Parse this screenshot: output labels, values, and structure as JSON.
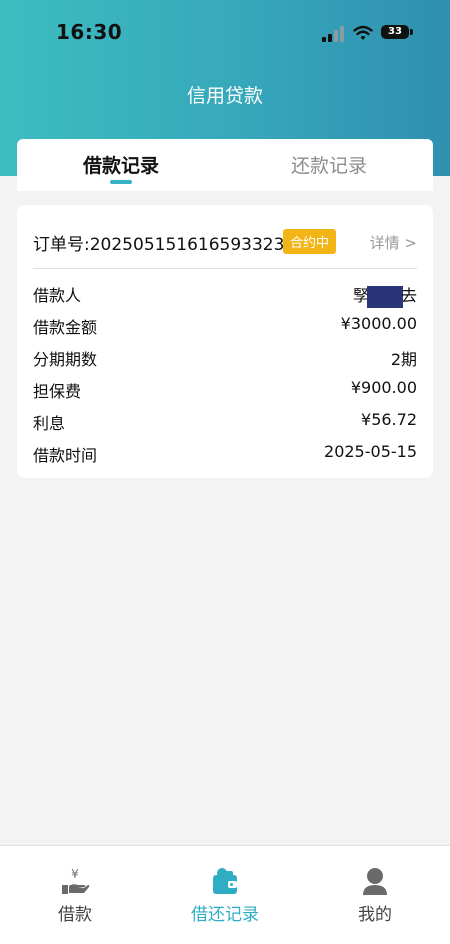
{
  "status_bar": {
    "time": "16:30",
    "battery": "33"
  },
  "header": {
    "title": "信用贷款"
  },
  "tabs": [
    {
      "label": "借款记录",
      "active": true
    },
    {
      "label": "还款记录",
      "active": false
    }
  ],
  "record": {
    "order_label": "订单号:",
    "order_number": "202505151616593323",
    "status": "合约中",
    "detail_label": "详情 >",
    "fields": [
      {
        "label": "借款人",
        "value_prefix": "孯",
        "value_suffix": "去"
      },
      {
        "label": "借款金额",
        "value": "¥3000.00"
      },
      {
        "label": "分期期数",
        "value": "2期"
      },
      {
        "label": "担保费",
        "value": "¥900.00"
      },
      {
        "label": "利息",
        "value": "¥56.72"
      },
      {
        "label": "借款时间",
        "value": "2025-05-15"
      }
    ]
  },
  "bottom_nav": [
    {
      "label": "借款",
      "icon": "loan-hand-yen-icon",
      "active": false
    },
    {
      "label": "借还记录",
      "icon": "wallet-icon",
      "active": true
    },
    {
      "label": "我的",
      "icon": "user-profile-icon",
      "active": false
    }
  ],
  "colors": {
    "header_gradient_start": "#3dbdc0",
    "header_gradient_end": "#2f8fb0",
    "accent": "#2faec3",
    "badge": "#f3b416",
    "redaction": "#283577"
  }
}
